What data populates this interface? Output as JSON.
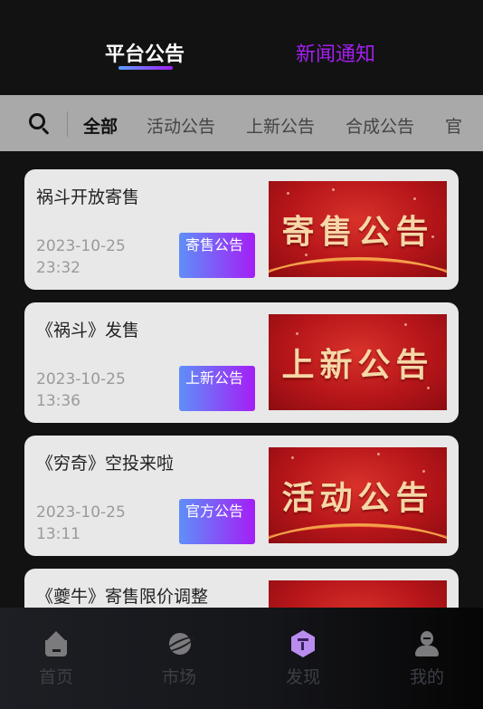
{
  "top_tabs": {
    "active": "平台公告",
    "inactive": "新闻通知"
  },
  "categories": [
    "全部",
    "活动公告",
    "上新公告",
    "合成公告",
    "官"
  ],
  "announcements": [
    {
      "title": "祸斗开放寄售",
      "date": "2023-10-25",
      "time": "23:32",
      "tag": "寄售公告",
      "banner": "寄售公告"
    },
    {
      "title": "《祸斗》发售",
      "date": "2023-10-25",
      "time": "13:36",
      "tag": "上新公告",
      "banner": "上新公告"
    },
    {
      "title": "《穷奇》空投来啦",
      "date": "2023-10-25",
      "time": "13:11",
      "tag": "官方公告",
      "banner": "活动公告"
    },
    {
      "title": "《夔牛》寄售限价调整",
      "date": "",
      "time": "",
      "tag": "",
      "banner": ""
    }
  ],
  "bottom_nav": [
    {
      "label": "首页",
      "icon": "home-icon"
    },
    {
      "label": "市场",
      "icon": "planet-icon"
    },
    {
      "label": "发现",
      "icon": "cube-icon"
    },
    {
      "label": "我的",
      "icon": "user-icon"
    }
  ],
  "colors": {
    "background": "#121212",
    "accent_purple": "#a21ff0",
    "category_bar": "#a9a9a9",
    "card": "#e8e8e8",
    "banner_red": "#c21a1e",
    "banner_text": "#f6d7a7"
  }
}
